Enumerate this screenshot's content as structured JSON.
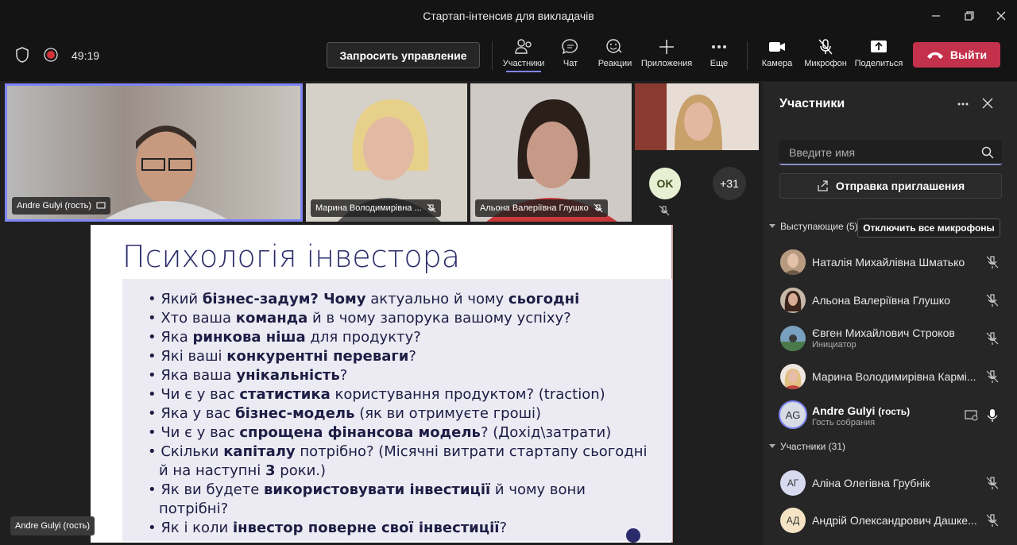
{
  "window": {
    "title": "Стартап-інтенсив для викладачів"
  },
  "toolbar": {
    "timer": "49:19",
    "request_control": "Запросить управление",
    "tools": {
      "participants": "Участники",
      "chat": "Чат",
      "reactions": "Реакции",
      "apps": "Приложения",
      "more": "Еще",
      "camera": "Камера",
      "mic": "Микрофон",
      "share": "Поделиться"
    },
    "leave": "Выйти"
  },
  "tiles": [
    {
      "name": "Andre Gulyi (гость)"
    },
    {
      "name": "Марина Володимирівна ..."
    },
    {
      "name": "Альона Валеріївна Глушко"
    }
  ],
  "overflow": {
    "initials": "OK",
    "more": "+31"
  },
  "presenter_label": "Andre Gulyi (гость)",
  "slide": {
    "title": "Психологія інвестора",
    "items": [
      [
        "Який ",
        "бізнес-задум? Чому",
        " актуально й чому ",
        "сьогодні",
        ""
      ],
      [
        "Хто ваша ",
        "команда",
        " й в чому запорука вашому успіху?",
        "",
        ""
      ],
      [
        "Яка ",
        "ринкова ніша",
        " для продукту?",
        "",
        ""
      ],
      [
        "Які ваші ",
        "конкурентні переваги",
        "?",
        "",
        ""
      ],
      [
        "Яка ваша ",
        "унікальність",
        "?",
        "",
        ""
      ],
      [
        "Чи є у вас ",
        "статистика",
        " користування продуктом? (traction)",
        "",
        ""
      ],
      [
        "Яка у вас ",
        "бізнес-модель",
        " (як ви отримуєте гроші)",
        "",
        ""
      ],
      [
        "Чи є у вас ",
        "спрощена фінансова модель",
        "? (Дохід\\затрати)",
        "",
        ""
      ],
      [
        "Скільки ",
        "капіталу",
        " потрібно? (Місячні витрати стартапу сьогодні й на наступні ",
        "3",
        " роки.)"
      ],
      [
        "Як ви будете ",
        "використовувати інвестиції",
        " й чому вони потрібні?",
        "",
        ""
      ],
      [
        "Як і коли ",
        "інвестор поверне свої інвестиції",
        "?",
        "",
        ""
      ]
    ]
  },
  "panel": {
    "title": "Участники",
    "search_placeholder": "Введите имя",
    "invite": "Отправка приглашения",
    "presenters_label": "Выступающие (5)",
    "mute_all": "Отключить все микрофоны",
    "presenters": [
      {
        "name": "Наталія Михайлівна Шматько",
        "sub": ""
      },
      {
        "name": "Альона Валеріївна Глушко",
        "sub": ""
      },
      {
        "name": "Євген Михайлович Строков",
        "sub": "Инициатор"
      },
      {
        "name": "Марина Володимирівна Кармі...",
        "sub": ""
      },
      {
        "name": "Andre Gulyi",
        "suffix": "(гость)",
        "sub": "Гость собрания",
        "initials": "AG"
      }
    ],
    "attendees_label": "Участники (31)",
    "attendees": [
      {
        "name": "Аліна Олегівна Грубнік",
        "initials": "АГ"
      },
      {
        "name": "Андрій Олександрович Дашке...",
        "initials": "АД"
      }
    ]
  }
}
